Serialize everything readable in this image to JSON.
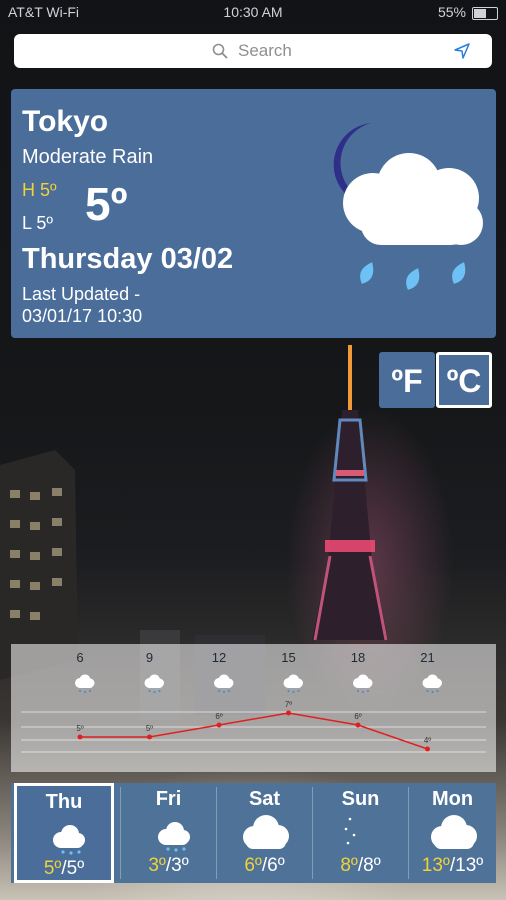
{
  "status_bar": {
    "carrier": "AT&T Wi-Fi",
    "time": "10:30 AM",
    "battery": "55%"
  },
  "search": {
    "placeholder": "Search"
  },
  "current": {
    "city": "Tokyo",
    "condition": "Moderate Rain",
    "high": "H 5º",
    "low": "L 5º",
    "temp": "5º",
    "date": "Thursday 03/02",
    "last_updated_label": "Last Updated -",
    "last_updated_value": "03/01/17 10:30",
    "icon": "moon-cloud-rain-icon"
  },
  "units": {
    "fahrenheit": "ºF",
    "celsius": "ºC",
    "selected": "celsius"
  },
  "hourly": {
    "hours": [
      "6",
      "9",
      "12",
      "15",
      "18",
      "21"
    ],
    "icon": "moon-cloud-rain-icon",
    "temp_labels": [
      "5º",
      "5º",
      "6º",
      "7º",
      "6º",
      "4º"
    ],
    "chart_data": {
      "type": "line",
      "x": [
        6,
        9,
        12,
        15,
        18,
        21
      ],
      "values": [
        5,
        5,
        6,
        7,
        6,
        4
      ],
      "color": "#e02020"
    }
  },
  "daily": [
    {
      "day": "Thu",
      "high": "5º",
      "low": "5º",
      "icon": "moon-cloud-rain-icon",
      "selected": true
    },
    {
      "day": "Fri",
      "high": "3º",
      "low": "3º",
      "icon": "moon-cloud-rain-icon",
      "selected": false
    },
    {
      "day": "Sat",
      "high": "6º",
      "low": "6º",
      "icon": "cloud-icon",
      "selected": false
    },
    {
      "day": "Sun",
      "high": "8º",
      "low": "8º",
      "icon": "moon-stars-icon",
      "selected": false
    },
    {
      "day": "Mon",
      "high": "13º",
      "low": "13º",
      "icon": "cloud-icon",
      "selected": false
    }
  ],
  "colors": {
    "card": "#4a6d99",
    "high_temp": "#f0d23b",
    "chart_line": "#e02020"
  }
}
